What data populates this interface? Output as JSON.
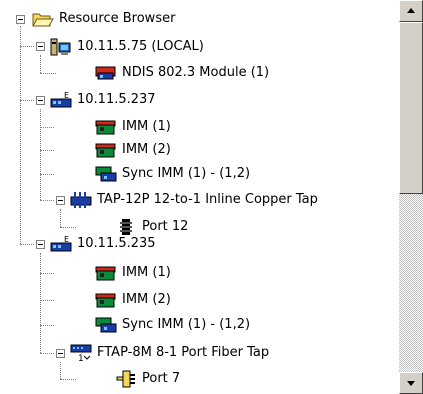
{
  "tree": {
    "root": "Resource Browser",
    "nodes": [
      {
        "label": "10.11.5.75 (LOCAL)",
        "icon": "local-computer-icon"
      },
      {
        "label": "NDIS 802.3 Module (1)",
        "icon": "network-card-icon"
      },
      {
        "label": "10.11.5.237",
        "icon": "chassis-icon"
      },
      {
        "label": "IMM (1)",
        "icon": "module-card-icon"
      },
      {
        "label": "IMM (2)",
        "icon": "module-card-icon"
      },
      {
        "label": "Sync IMM (1) - (1,2)",
        "icon": "sync-module-icon"
      },
      {
        "label": "TAP-12P 12-to-1 Inline Copper Tap",
        "icon": "copper-tap-icon"
      },
      {
        "label": "Port 12",
        "icon": "port-icon"
      },
      {
        "label": "10.11.5.235",
        "icon": "chassis-icon"
      },
      {
        "label": "IMM (1)",
        "icon": "module-card-icon"
      },
      {
        "label": "IMM (2)",
        "icon": "module-card-icon"
      },
      {
        "label": "Sync IMM (1) - (1,2)",
        "icon": "sync-module-icon"
      },
      {
        "label": "FTAP-8M 8-1 Port Fiber Tap",
        "icon": "fiber-tap-icon"
      },
      {
        "label": "Port 7",
        "icon": "fiber-port-icon"
      }
    ]
  },
  "colors": {
    "card_green": "#0a8a3a",
    "card_blue": "#1a3ca8",
    "folder_yellow": "#f4d75a",
    "scrollbar_face": "#d4d0c8"
  }
}
